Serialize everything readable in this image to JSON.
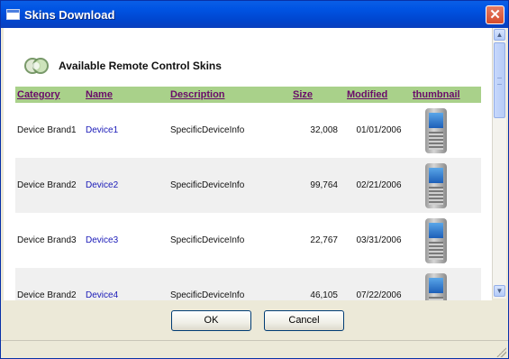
{
  "window": {
    "title": "Skins Download",
    "close_glyph": "✕"
  },
  "content": {
    "heading": "Available Remote Control Skins",
    "logo_icon": "skins-logo-icon"
  },
  "table": {
    "headers": {
      "category": "Category",
      "name": "Name",
      "description": "Description",
      "size": "Size",
      "modified": "Modified",
      "thumbnail": "thumbnail"
    },
    "rows": [
      {
        "category": "Device Brand1",
        "name": "Device1",
        "description": "SpecificDeviceInfo",
        "size": "32,008",
        "modified": "01/01/2006"
      },
      {
        "category": "Device Brand2",
        "name": "Device2",
        "description": "SpecificDeviceInfo",
        "size": "99,764",
        "modified": "02/21/2006"
      },
      {
        "category": "Device Brand3",
        "name": "Device3",
        "description": "SpecificDeviceInfo",
        "size": "22,767",
        "modified": "03/31/2006"
      },
      {
        "category": "Device Brand2",
        "name": "Device4",
        "description": "SpecificDeviceInfo",
        "size": "46,105",
        "modified": "07/22/2006"
      }
    ]
  },
  "scrollbar": {
    "up_glyph": "▲",
    "down_glyph": "▼"
  },
  "buttons": {
    "ok": "OK",
    "cancel": "Cancel"
  },
  "colors": {
    "header_bg": "#a9d18a",
    "link": "#1a1ab8",
    "titlebar": "#0054e3"
  }
}
